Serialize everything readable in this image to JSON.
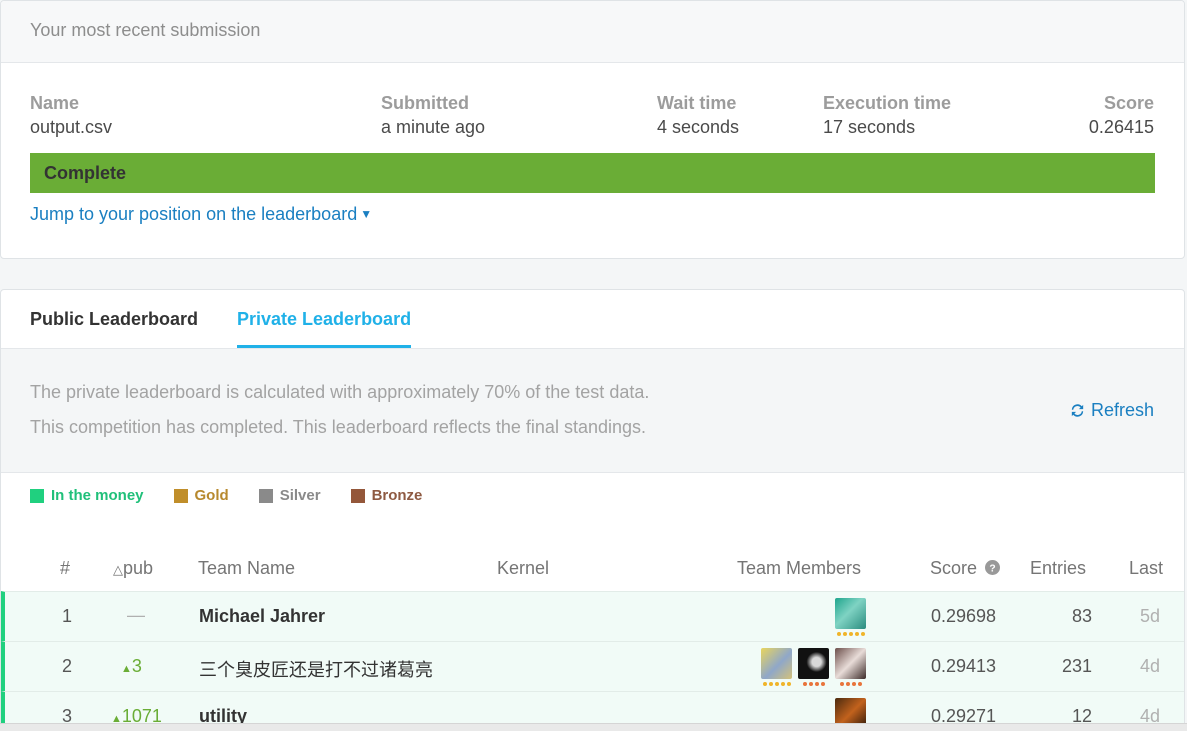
{
  "submission": {
    "heading": "Your most recent submission",
    "columns": [
      {
        "label": "Name",
        "value": "output.csv"
      },
      {
        "label": "Submitted",
        "value": "a minute ago"
      },
      {
        "label": "Wait time",
        "value": "4 seconds"
      },
      {
        "label": "Execution time",
        "value": "17 seconds"
      },
      {
        "label": "Score",
        "value": "0.26415"
      }
    ],
    "status": "Complete",
    "status_color": "#6aad36",
    "jump_link": "Jump to your position on the leaderboard"
  },
  "leaderboard": {
    "tabs": [
      {
        "label": "Public Leaderboard",
        "active": false
      },
      {
        "label": "Private Leaderboard",
        "active": true
      }
    ],
    "info_line1": "The private leaderboard is calculated with approximately 70% of the test data.",
    "info_line2": "This competition has completed. This leaderboard reflects the final standings.",
    "refresh_label": "Refresh",
    "legend": [
      {
        "label": "In the money",
        "color": "#20d07f"
      },
      {
        "label": "Gold",
        "color": "#c08e2a"
      },
      {
        "label": "Silver",
        "color": "#8a8a8a"
      },
      {
        "label": "Bronze",
        "color": "#94573a"
      }
    ],
    "headers": {
      "rank": "#",
      "pub": "pub",
      "team": "Team Name",
      "kernel": "Kernel",
      "members": "Team Members",
      "score": "Score",
      "entries": "Entries",
      "last": "Last"
    },
    "rows": [
      {
        "rank": "1",
        "delta": "—",
        "team": "Michael Jahrer",
        "score": "0.29698",
        "entries": "83",
        "last": "5d"
      },
      {
        "rank": "2",
        "delta": "3",
        "team": "三个臭皮匠还是打不过诸葛亮",
        "score": "0.29413",
        "entries": "231",
        "last": "4d"
      },
      {
        "rank": "3",
        "delta": "1071",
        "team": "utility",
        "score": "0.29271",
        "entries": "12",
        "last": "4d"
      }
    ]
  }
}
